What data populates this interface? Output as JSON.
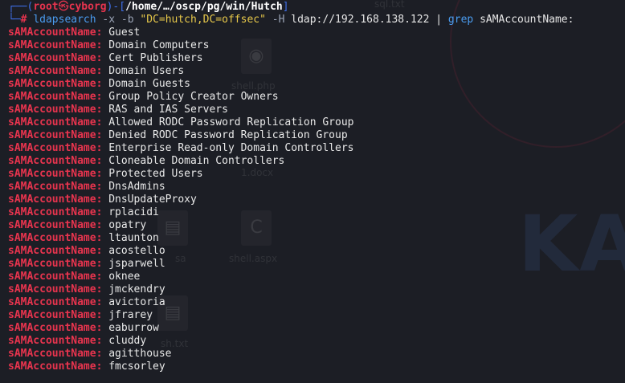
{
  "prompt": {
    "line1_open": "┌──(",
    "user": "root",
    "skull_icon": "㉿",
    "host": "cyborg",
    "line1_mid": ")-[",
    "path": "/home/…/oscp/pg/win/Hutch",
    "line1_close": "]",
    "line2_frame": "└─",
    "hash": "#"
  },
  "command": {
    "program": "ldapsearch",
    "flag_x": "-x",
    "flag_b": "-b",
    "base_dn": "\"DC=hutch,DC=offsec\"",
    "flag_H": "-H",
    "uri": "ldap://192.168.138.122",
    "pipe": "|",
    "grep": "grep",
    "pattern": "sAMAccountName:"
  },
  "output": {
    "key": "sAMAccountName:",
    "values": [
      "Guest",
      "Domain Computers",
      "Cert Publishers",
      "Domain Users",
      "Domain Guests",
      "Group Policy Creator Owners",
      "RAS and IAS Servers",
      "Allowed RODC Password Replication Group",
      "Denied RODC Password Replication Group",
      "Enterprise Read-only Domain Controllers",
      "Cloneable Domain Controllers",
      "Protected Users",
      "DnsAdmins",
      "DnsUpdateProxy",
      "rplacidi",
      "opatry",
      "ltaunton",
      "acostello",
      "jsparwell",
      "oknee",
      "jmckendry",
      "avictoria",
      "jfrarey",
      "eaburrow",
      "cluddy",
      "agitthouse",
      "fmcsorley"
    ]
  },
  "desktop": {
    "labels": [
      "sql.txt",
      "shell.php",
      "1.docx",
      "shell.aspx",
      "sa",
      "sh.txt"
    ],
    "watermark": "KA"
  },
  "colors": {
    "background": "#1c1e25",
    "frame": "#3f6fe8",
    "root": "#e8344e",
    "command": "#4a9cf0",
    "string": "#e8c94a",
    "text": "#e9e9e9"
  }
}
